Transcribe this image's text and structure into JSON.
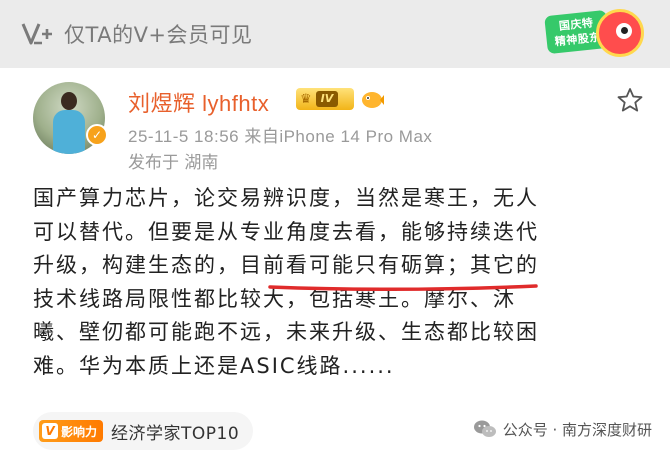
{
  "banner": {
    "text": "仅TA的V+会员可见",
    "mascot_text_line1": "国庆特",
    "mascot_text_line2": "精神股东"
  },
  "post": {
    "author": "刘煜辉 lyhfhtx",
    "level_badge": "IV",
    "meta": "25-11-5 18:56  来自iPhone 14 Pro Max",
    "location": "发布于 湖南",
    "body_lines": [
      "国产算力芯片，论交易辨识度，当然是寒王，无人",
      "可以替代。但要是从专业角度去看，能够持续迭代",
      "升级，构建生态的，目前看可能只有砺算；其它的",
      "技术线路局限性都比较大，包括寒王。摩尔、沐",
      "曦、壁仞都可能跑不远，未来升级、生态都比较困",
      "难。华为本质上还是ASIC线路......"
    ]
  },
  "influence": {
    "tag": "影响力",
    "tag_letter": "V",
    "text": "经济学家TOP10"
  },
  "watermark": {
    "text": "公众号 · 南方深度财研"
  },
  "colors": {
    "author": "#e8602c",
    "underline": "#e02b2b",
    "influence_tag": "#ff8a00"
  },
  "icons": {
    "vplus": "vplus-logo-icon",
    "star": "star-outline-icon",
    "verify": "verified-badge-icon",
    "wechat": "wechat-icon"
  }
}
